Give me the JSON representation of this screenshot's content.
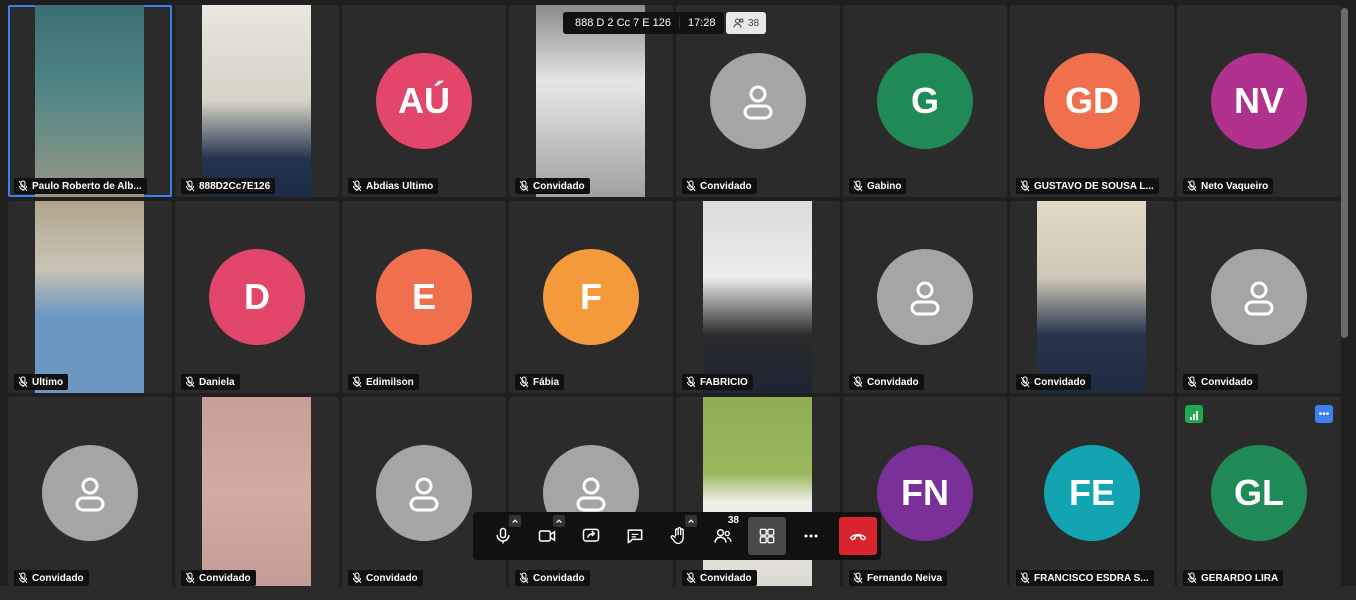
{
  "meeting_bar": {
    "room_id": "888 D 2 Cc 7 E 126",
    "time": "17:28",
    "participant_count": "38"
  },
  "toolbar": {
    "participants_badge": "38"
  },
  "colors": {
    "active_border": "#3d7ff0",
    "end_call": "#d9232e"
  },
  "tiles": [
    {
      "name": "Paulo Roberto de Alb...",
      "kind": "video",
      "bg": "linear-gradient(#3b6f73 0%,#4d8486 40%,#6f8f86 70%,#9b9582 100%)",
      "active": true
    },
    {
      "name": "888D2Cc7E126",
      "kind": "video",
      "bg": "linear-gradient(#e9e7df,#d6d3c6 50%,#23344f 80%,#1c2b44)"
    },
    {
      "name": "Abdias Último",
      "kind": "initials",
      "initials": "AÚ",
      "color": "#e2466b"
    },
    {
      "name": "Convidado",
      "kind": "video",
      "bg": "linear-gradient(#8a8c8a,#e6e6e4 40%,#d0d0ce 60%,#a0a0a0)"
    },
    {
      "name": "Convidado",
      "kind": "person"
    },
    {
      "name": "Gabino",
      "kind": "initials",
      "initials": "G",
      "color": "#1f8a56"
    },
    {
      "name": "GUSTAVO DE SOUSA L...",
      "kind": "initials",
      "initials": "GD",
      "color": "#f0704d"
    },
    {
      "name": "Neto Vaqueiro",
      "kind": "initials",
      "initials": "NV",
      "color": "#b0318e"
    },
    {
      "name": "Último",
      "kind": "video",
      "bg": "linear-gradient(#b2a48f,#c9c3b4 35%,#6b97c2 60%,#6b97c2)"
    },
    {
      "name": "Daniela",
      "kind": "initials",
      "initials": "D",
      "color": "#e2466b"
    },
    {
      "name": "Edimilson",
      "kind": "initials",
      "initials": "E",
      "color": "#f0704d"
    },
    {
      "name": "Fábia",
      "kind": "initials",
      "initials": "F",
      "color": "#f59a3a"
    },
    {
      "name": "FABRÍCIO",
      "kind": "video",
      "bg": "linear-gradient(#dcdcdc,#ececec 40%,#2a2a2a 70%,#1d2434)"
    },
    {
      "name": "Convidado",
      "kind": "person"
    },
    {
      "name": "Convidado",
      "kind": "video",
      "bg": "linear-gradient(#e4d9c7,#cfc7b6 40%,#27344c 70%,#1e2a40)"
    },
    {
      "name": "Convidado",
      "kind": "person"
    },
    {
      "name": "Convidado",
      "kind": "person"
    },
    {
      "name": "Convidado",
      "kind": "video",
      "bg": "linear-gradient(#c99e98,#d6aaa4 50%,#c49b96)"
    },
    {
      "name": "Convidado",
      "kind": "person"
    },
    {
      "name": "Convidado",
      "kind": "person"
    },
    {
      "name": "Convidado",
      "kind": "video",
      "bg": "linear-gradient(#8fae54,#9ab95e 40%,#f0efe9 55%,#dbd9d2)"
    },
    {
      "name": "Fernando Neiva",
      "kind": "initials",
      "initials": "FN",
      "color": "#7b2f98"
    },
    {
      "name": "FRANCISCO ESDRA S...",
      "kind": "initials",
      "initials": "FE",
      "color": "#12a4b1"
    },
    {
      "name": "GERARDO LIRA",
      "kind": "initials",
      "initials": "GL",
      "color": "#1f8a56",
      "extras": true
    }
  ]
}
